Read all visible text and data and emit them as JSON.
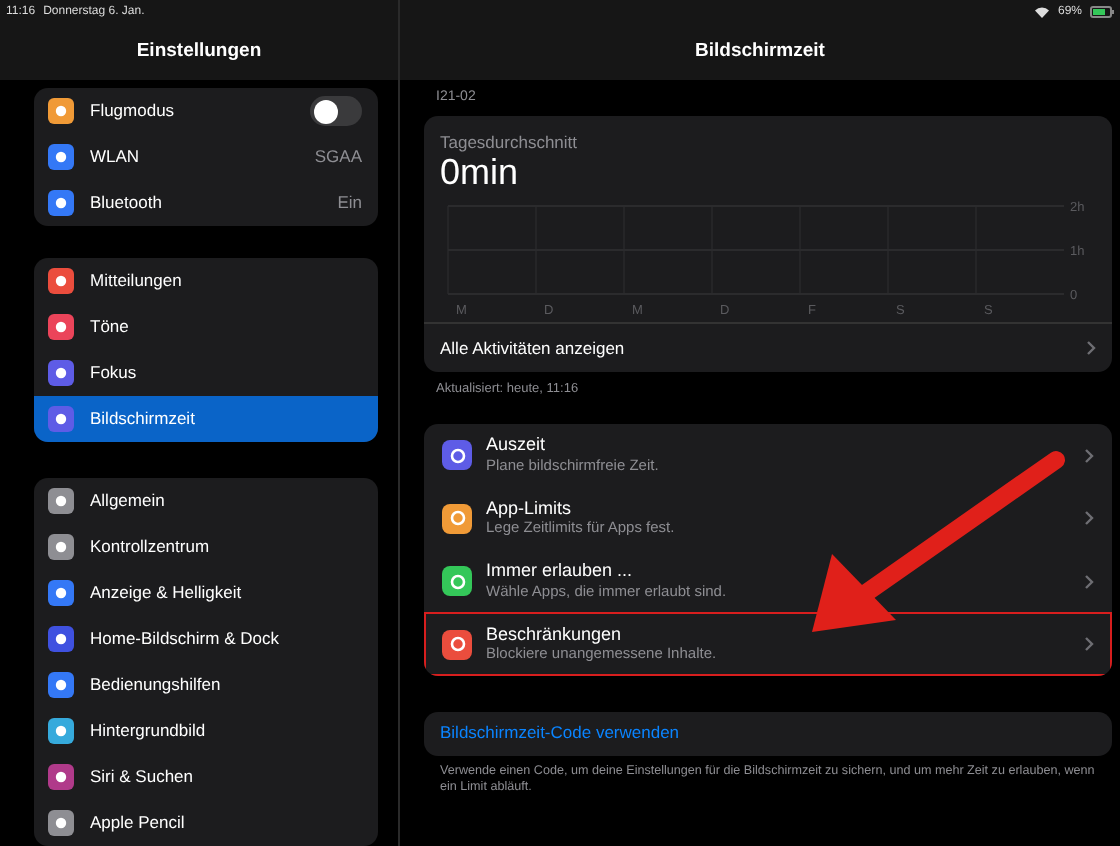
{
  "status_bar": {
    "time": "11:16",
    "date": "Donnerstag 6. Jan.",
    "battery": "69%"
  },
  "sidebar": {
    "title": "Einstellungen",
    "groups": [
      {
        "items": [
          {
            "label": "Flugmodus",
            "color": "#f09a37",
            "kind": "toggle",
            "on": false,
            "selected": false
          },
          {
            "label": "WLAN",
            "color": "#3478f6",
            "kind": "value",
            "value": "SGAA",
            "selected": false
          },
          {
            "label": "Bluetooth",
            "color": "#3478f6",
            "kind": "value",
            "value": "Ein",
            "selected": false
          }
        ]
      },
      {
        "items": [
          {
            "label": "Mitteilungen",
            "color": "#eb4d3d",
            "kind": "plain",
            "selected": false
          },
          {
            "label": "Töne",
            "color": "#eb445a",
            "kind": "plain",
            "selected": false
          },
          {
            "label": "Fokus",
            "color": "#5e5ce6",
            "kind": "plain",
            "selected": false
          },
          {
            "label": "Bildschirmzeit",
            "color": "#5e5ce6",
            "kind": "plain",
            "selected": true
          }
        ]
      },
      {
        "items": [
          {
            "label": "Allgemein",
            "color": "#8e8e93",
            "kind": "plain",
            "selected": false
          },
          {
            "label": "Kontrollzentrum",
            "color": "#8e8e93",
            "kind": "plain",
            "selected": false
          },
          {
            "label": "Anzeige & Helligkeit",
            "color": "#3478f6",
            "kind": "plain",
            "selected": false
          },
          {
            "label": "Home-Bildschirm & Dock",
            "color": "#3f51e0",
            "kind": "plain",
            "selected": false
          },
          {
            "label": "Bedienungshilfen",
            "color": "#3478f6",
            "kind": "plain",
            "selected": false
          },
          {
            "label": "Hintergrundbild",
            "color": "#36aadc",
            "kind": "plain",
            "selected": false
          },
          {
            "label": "Siri & Suchen",
            "color": "#b03a8a",
            "kind": "plain",
            "selected": false
          },
          {
            "label": "Apple Pencil",
            "color": "#8e8e93",
            "kind": "plain",
            "selected": false
          }
        ]
      }
    ]
  },
  "detail": {
    "title": "Bildschirmzeit",
    "device": "I21-02",
    "summary": {
      "label": "Tagesdurchschnitt",
      "value": "0min",
      "chart_data": {
        "type": "bar",
        "categories": [
          "M",
          "D",
          "M",
          "D",
          "F",
          "S",
          "S"
        ],
        "values": [
          0,
          0,
          0,
          0,
          0,
          0,
          0
        ],
        "ylim": [
          0,
          2
        ],
        "yticks": [
          {
            "value": 2,
            "label": "2h"
          },
          {
            "value": 1,
            "label": "1h"
          },
          {
            "value": 0,
            "label": "0"
          }
        ]
      },
      "link": "Alle Aktivitäten anzeigen"
    },
    "updated": "Aktualisiert: heute, 11:16",
    "options": [
      {
        "title": "Auszeit",
        "subtitle": "Plane bildschirmfreie Zeit.",
        "color": "#5e5ce6",
        "highlighted": false
      },
      {
        "title": "App-Limits",
        "subtitle": "Lege Zeitlimits für Apps fest.",
        "color": "#f09a37",
        "highlighted": false
      },
      {
        "title": "Immer erlauben ...",
        "subtitle": "Wähle Apps, die immer erlaubt sind.",
        "color": "#34c759",
        "highlighted": false
      },
      {
        "title": "Beschränkungen",
        "subtitle": "Blockiere unangemessene Inhalte.",
        "color": "#eb4d3d",
        "highlighted": true
      }
    ],
    "code_link": "Bildschirmzeit-Code verwenden",
    "code_note": "Verwende einen Code, um deine Einstellungen für die Bildschirmzeit zu sichern, und um mehr Zeit zu erlauben, wenn ein Limit abläuft."
  }
}
